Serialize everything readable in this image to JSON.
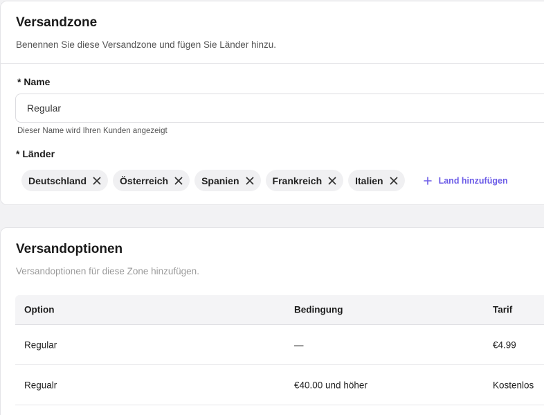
{
  "zone": {
    "title": "Versandzone",
    "subtitle": "Benennen Sie diese Versandzone und fügen Sie Länder hinzu.",
    "name_label": "* Name",
    "name_value": "Regular",
    "name_hint": "Dieser Name wird Ihren Kunden angezeigt",
    "countries_label": "* Länder",
    "countries": [
      {
        "label": "Deutschland"
      },
      {
        "label": "Österreich"
      },
      {
        "label": "Spanien"
      },
      {
        "label": "Frankreich"
      },
      {
        "label": "Italien"
      }
    ],
    "add_country_label": "Land hinzufügen"
  },
  "options": {
    "title": "Versandoptionen",
    "subtitle": "Versandoptionen für diese Zone hinzufügen.",
    "columns": [
      "Option",
      "Bedingung",
      "Tarif"
    ],
    "rows": [
      {
        "option": "Regular",
        "condition": "—",
        "rate": "€4.99"
      },
      {
        "option": "Regualr",
        "condition": "€40.00 und höher",
        "rate": "Kostenlos"
      }
    ]
  },
  "colors": {
    "accent": "#6c5ce7",
    "chip_bg": "#f0f0f2",
    "page_bg": "#f2f2f4"
  },
  "icons": {
    "chip_remove": "close-icon",
    "add": "plus-icon"
  }
}
